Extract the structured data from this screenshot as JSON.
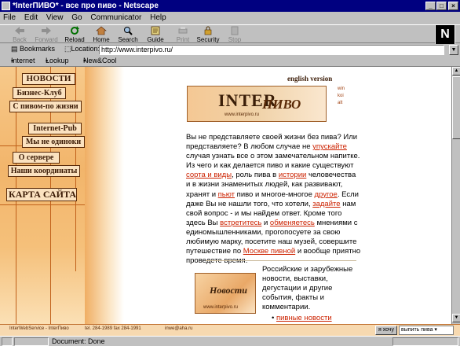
{
  "window": {
    "title": "*InterПИВО* - все про пиво - Netscape"
  },
  "menu": [
    "File",
    "Edit",
    "View",
    "Go",
    "Communicator",
    "Help"
  ],
  "toolbar": {
    "back": "Back",
    "forward": "Forward",
    "reload": "Reload",
    "home": "Home",
    "search": "Search",
    "guide": "Guide",
    "print": "Print",
    "security": "Security",
    "stop": "Stop"
  },
  "location": {
    "bookmarks": "Bookmarks",
    "label": "Location:",
    "url": "http://www.interpivo.ru/"
  },
  "personal_toolbar": [
    "Internet",
    "Lookup",
    "New&Cool"
  ],
  "nav": {
    "news": "НОВОСТИ",
    "business": "Бизнес-Клуб",
    "withbeer": "С пивом-по жизни",
    "pub": "Internet-Pub",
    "notalone": "Мы не одиноки",
    "about": "О сервере",
    "contacts": "Наши координаты",
    "sitemap": "КАРТА САЙТА"
  },
  "logo": {
    "english": "english version",
    "word": "INTER",
    "script": "ПИВО",
    "url": "www.interpivo.ru",
    "langs": [
      "win",
      "koi",
      "alt"
    ]
  },
  "main": {
    "p1": "Вы не представляете своей жизни без пива? Или представляете? В любом случае не ",
    "l1": "упускайте",
    "p2": " случая узнать все о этом замечательном напитке. Из чего и как делается пиво и какие существуют ",
    "l2": "сорта и виды",
    "p3": ", роль пива в ",
    "l3": "истории",
    "p4": " человечества и в жизни знаменитых людей, как развивают, хранят и ",
    "l4": "пьют",
    "p5": " пиво и многое-многое ",
    "l5": "другое",
    "p6": ". Если даже Вы не нашли того, что хотели, ",
    "l6": "задайте",
    "p7": " нам свой вопрос - и мы найдем ответ. Кроме того здесь Вы ",
    "l7": "встретитесь",
    "p8": " и ",
    "l8": "обменяетесь",
    "p9": " мнениями с единомышленниками, прогопосуете за свою любимую марку, посетите наш музей, совершите путешествие по ",
    "l9": "Москве пивной",
    "p10": " и вообще приятно проведете время."
  },
  "news": {
    "img_title": "Новости",
    "img_url": "www.interpivo.ru",
    "text": "Российские и зарубежные новости, выставки, дегустации и другие события, факты и комментарии.",
    "link": "пивные новости"
  },
  "footer": {
    "service": "InterWebService - InterПиво",
    "tel": "tel. 284-1989  fax 284-1991",
    "email": "inwe@aha.ru",
    "want_btn": "я хочу",
    "select": "выпить пива"
  },
  "status": {
    "text": "Document: Done"
  }
}
